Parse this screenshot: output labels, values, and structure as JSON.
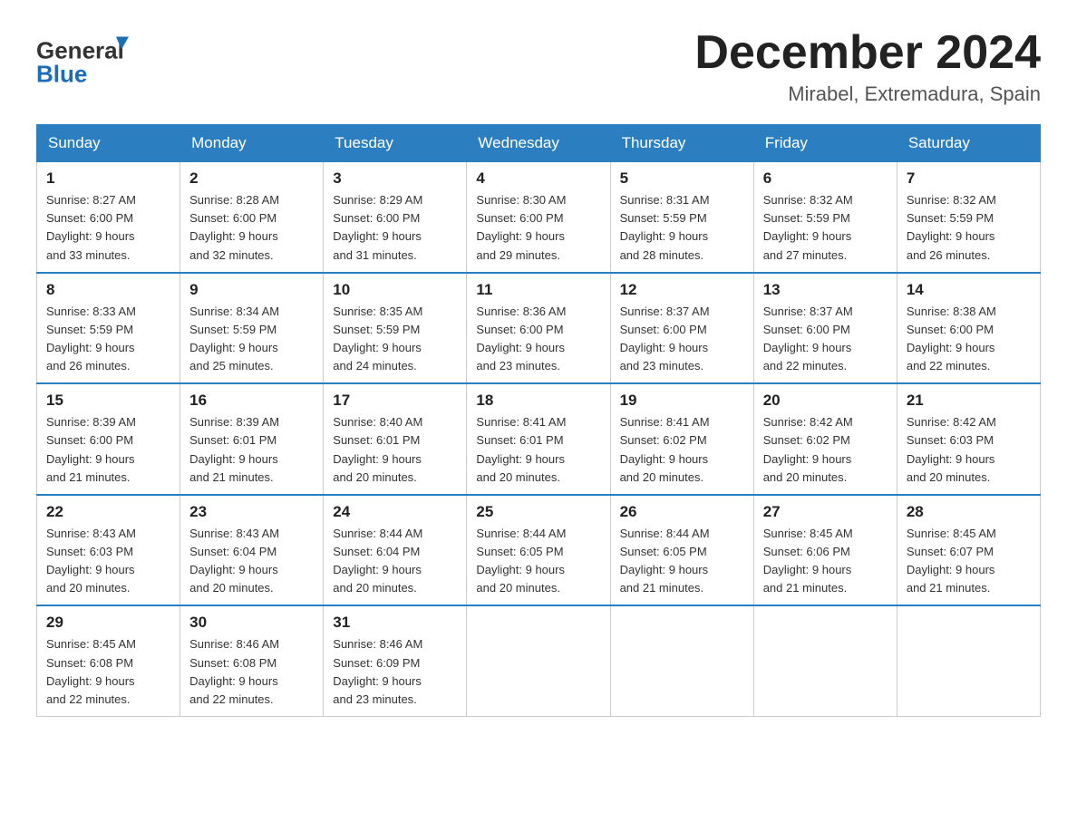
{
  "header": {
    "logo_text_general": "General",
    "logo_text_blue": "Blue",
    "month_title": "December 2024",
    "location": "Mirabel, Extremadura, Spain"
  },
  "days_of_week": [
    "Sunday",
    "Monday",
    "Tuesday",
    "Wednesday",
    "Thursday",
    "Friday",
    "Saturday"
  ],
  "weeks": [
    [
      {
        "day": "1",
        "sunrise": "8:27 AM",
        "sunset": "6:00 PM",
        "daylight": "9 hours and 33 minutes."
      },
      {
        "day": "2",
        "sunrise": "8:28 AM",
        "sunset": "6:00 PM",
        "daylight": "9 hours and 32 minutes."
      },
      {
        "day": "3",
        "sunrise": "8:29 AM",
        "sunset": "6:00 PM",
        "daylight": "9 hours and 31 minutes."
      },
      {
        "day": "4",
        "sunrise": "8:30 AM",
        "sunset": "6:00 PM",
        "daylight": "9 hours and 29 minutes."
      },
      {
        "day": "5",
        "sunrise": "8:31 AM",
        "sunset": "5:59 PM",
        "daylight": "9 hours and 28 minutes."
      },
      {
        "day": "6",
        "sunrise": "8:32 AM",
        "sunset": "5:59 PM",
        "daylight": "9 hours and 27 minutes."
      },
      {
        "day": "7",
        "sunrise": "8:32 AM",
        "sunset": "5:59 PM",
        "daylight": "9 hours and 26 minutes."
      }
    ],
    [
      {
        "day": "8",
        "sunrise": "8:33 AM",
        "sunset": "5:59 PM",
        "daylight": "9 hours and 26 minutes."
      },
      {
        "day": "9",
        "sunrise": "8:34 AM",
        "sunset": "5:59 PM",
        "daylight": "9 hours and 25 minutes."
      },
      {
        "day": "10",
        "sunrise": "8:35 AM",
        "sunset": "5:59 PM",
        "daylight": "9 hours and 24 minutes."
      },
      {
        "day": "11",
        "sunrise": "8:36 AM",
        "sunset": "6:00 PM",
        "daylight": "9 hours and 23 minutes."
      },
      {
        "day": "12",
        "sunrise": "8:37 AM",
        "sunset": "6:00 PM",
        "daylight": "9 hours and 23 minutes."
      },
      {
        "day": "13",
        "sunrise": "8:37 AM",
        "sunset": "6:00 PM",
        "daylight": "9 hours and 22 minutes."
      },
      {
        "day": "14",
        "sunrise": "8:38 AM",
        "sunset": "6:00 PM",
        "daylight": "9 hours and 22 minutes."
      }
    ],
    [
      {
        "day": "15",
        "sunrise": "8:39 AM",
        "sunset": "6:00 PM",
        "daylight": "9 hours and 21 minutes."
      },
      {
        "day": "16",
        "sunrise": "8:39 AM",
        "sunset": "6:01 PM",
        "daylight": "9 hours and 21 minutes."
      },
      {
        "day": "17",
        "sunrise": "8:40 AM",
        "sunset": "6:01 PM",
        "daylight": "9 hours and 20 minutes."
      },
      {
        "day": "18",
        "sunrise": "8:41 AM",
        "sunset": "6:01 PM",
        "daylight": "9 hours and 20 minutes."
      },
      {
        "day": "19",
        "sunrise": "8:41 AM",
        "sunset": "6:02 PM",
        "daylight": "9 hours and 20 minutes."
      },
      {
        "day": "20",
        "sunrise": "8:42 AM",
        "sunset": "6:02 PM",
        "daylight": "9 hours and 20 minutes."
      },
      {
        "day": "21",
        "sunrise": "8:42 AM",
        "sunset": "6:03 PM",
        "daylight": "9 hours and 20 minutes."
      }
    ],
    [
      {
        "day": "22",
        "sunrise": "8:43 AM",
        "sunset": "6:03 PM",
        "daylight": "9 hours and 20 minutes."
      },
      {
        "day": "23",
        "sunrise": "8:43 AM",
        "sunset": "6:04 PM",
        "daylight": "9 hours and 20 minutes."
      },
      {
        "day": "24",
        "sunrise": "8:44 AM",
        "sunset": "6:04 PM",
        "daylight": "9 hours and 20 minutes."
      },
      {
        "day": "25",
        "sunrise": "8:44 AM",
        "sunset": "6:05 PM",
        "daylight": "9 hours and 20 minutes."
      },
      {
        "day": "26",
        "sunrise": "8:44 AM",
        "sunset": "6:05 PM",
        "daylight": "9 hours and 21 minutes."
      },
      {
        "day": "27",
        "sunrise": "8:45 AM",
        "sunset": "6:06 PM",
        "daylight": "9 hours and 21 minutes."
      },
      {
        "day": "28",
        "sunrise": "8:45 AM",
        "sunset": "6:07 PM",
        "daylight": "9 hours and 21 minutes."
      }
    ],
    [
      {
        "day": "29",
        "sunrise": "8:45 AM",
        "sunset": "6:08 PM",
        "daylight": "9 hours and 22 minutes."
      },
      {
        "day": "30",
        "sunrise": "8:46 AM",
        "sunset": "6:08 PM",
        "daylight": "9 hours and 22 minutes."
      },
      {
        "day": "31",
        "sunrise": "8:46 AM",
        "sunset": "6:09 PM",
        "daylight": "9 hours and 23 minutes."
      },
      null,
      null,
      null,
      null
    ]
  ],
  "labels": {
    "sunrise": "Sunrise:",
    "sunset": "Sunset:",
    "daylight": "Daylight:"
  }
}
